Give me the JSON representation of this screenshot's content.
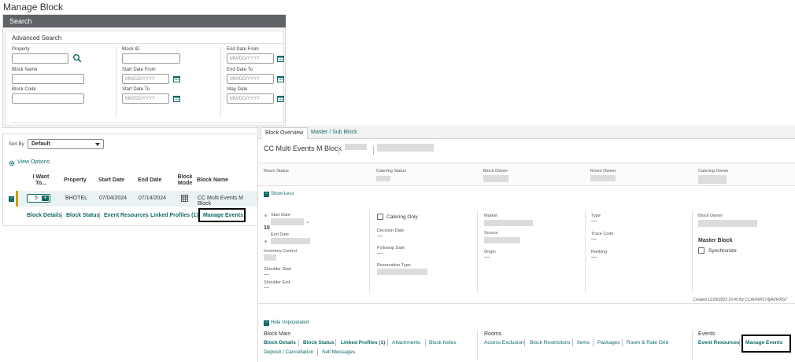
{
  "page_title": "Manage Block",
  "search": {
    "header": "Search",
    "advanced_title": "Advanced Search",
    "fields": {
      "property_label": "Property",
      "block_name_label": "Block Name",
      "block_code_label": "Block Code",
      "block_id_label": "Block ID",
      "start_date_from_label": "Start Date From",
      "start_date_from_placeholder": "MM/DD/YYYY",
      "start_date_to_label": "Start Date To",
      "start_date_to_placeholder": "MM/DD/YYYY",
      "end_date_from_label": "End Date From",
      "end_date_from_placeholder": "MM/DD/YYYY",
      "end_date_to_label": "End Date To",
      "end_date_to_placeholder": "MM/DD/YYYY",
      "stay_date_label": "Stay Date",
      "stay_date_placeholder": "MM/DD/YYYY"
    }
  },
  "results": {
    "sort_by_label": "Sort By",
    "sort_by_value": "Default",
    "view_options": "View Options",
    "columns": [
      "I Want To...",
      "Property",
      "Start Date",
      "End Date",
      "Block Mode",
      "Block Name"
    ],
    "row": {
      "count": "5",
      "property": "BHOTEL",
      "start_date": "07/04/2024",
      "end_date": "07/14/2024",
      "block_name": "CC Multi Events M Block"
    },
    "row_links": [
      "Block Details",
      "Block Status",
      "Event Resources",
      "Linked Profiles (1)",
      "Manage Events"
    ]
  },
  "detail": {
    "tabs": [
      "Block Overview",
      "Master / Sub Block"
    ],
    "block_title": "CC Multi Events M Block",
    "summary_labels": [
      "Room Status",
      "Catering Status",
      "Block Owner",
      "Room Owner",
      "Catering Owner"
    ],
    "show_less": "Show Less",
    "col1": {
      "start_date_label": "Start Date",
      "nights": "10",
      "end_date_label": "End Date",
      "inventory_control_label": "Inventory Control",
      "shoulder_start_label": "Shoulder Start",
      "shoulder_start_value": "—",
      "shoulder_end_label": "Shoulder End",
      "shoulder_end_value": "—"
    },
    "col2": {
      "catering_only_label": "Catering Only",
      "decision_date_label": "Decision Date",
      "decision_date_value": "—",
      "followup_date_label": "Followup Date",
      "followup_date_value": "—",
      "reservation_type_label": "Reservation Type"
    },
    "col3": {
      "market_label": "Market",
      "source_label": "Source",
      "origin_label": "Origin",
      "origin_value": "—"
    },
    "col4": {
      "type_label": "Type",
      "type_value": "—",
      "trace_code_label": "Trace Code",
      "trace_code_value": "—",
      "ranking_label": "Ranking",
      "ranking_value": "—"
    },
    "col5": {
      "block_owner_label": "Block Owner",
      "master_block_label": "Master Block",
      "synchronize_label": "Synchronize"
    },
    "created_text": "Created  11/29/2023 10:40  By  CCAVFIRST@AVFIRST",
    "hide_unpopulated": "Hide Unpopulated",
    "block_main_title": "Block Main",
    "block_main_links": [
      "Block Details",
      "Block Status",
      "Linked Profiles (1)",
      "Attachments",
      "Block Notes"
    ],
    "block_main_links2": [
      "Deposit / Cancellation",
      "Sell Messages"
    ],
    "rooms_title": "Rooms",
    "rooms_links": [
      "Access Exclusion",
      "Block Restrictions",
      "Items",
      "Packages",
      "Room & Rate Grid"
    ],
    "events_title": "Events",
    "events_links": [
      "Event Resources",
      "Manage Events"
    ]
  },
  "colors": {
    "accent": "#0f6a6a",
    "header": "#5f6367",
    "highlight_border": "#000000"
  }
}
